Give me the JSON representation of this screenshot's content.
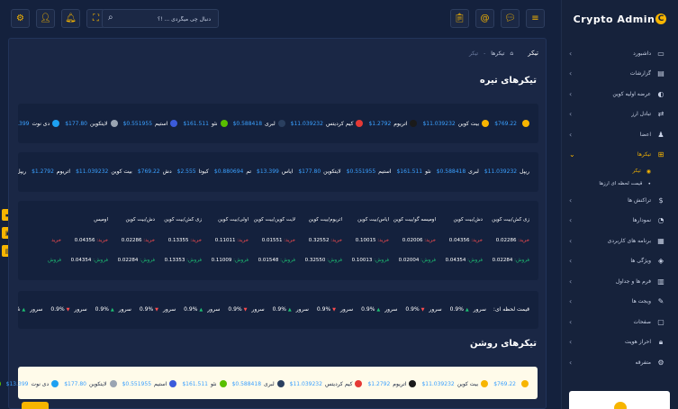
{
  "brand": {
    "name": "Crypto Admin",
    "mark": "C"
  },
  "sidebar": {
    "items": [
      {
        "label": "داشبورد",
        "icon": "monitor-icon"
      },
      {
        "label": "گزارشات",
        "icon": "report-icon"
      },
      {
        "label": "عرضه اولیه کوین",
        "icon": "coin-icon"
      },
      {
        "label": "تبادل ارز",
        "icon": "exchange-icon"
      },
      {
        "label": "اعضا",
        "icon": "users-icon"
      },
      {
        "label": "تیکرها",
        "icon": "ticker-icon"
      },
      {
        "label": "تراکنش ها",
        "icon": "dollar-icon"
      },
      {
        "label": "نمودارها",
        "icon": "chart-icon"
      },
      {
        "label": "برنامه های کاربردی",
        "icon": "apps-icon"
      },
      {
        "label": "ویژگی ها",
        "icon": "features-icon"
      },
      {
        "label": "فرم ها و جداول",
        "icon": "forms-icon"
      },
      {
        "label": "ویجت ها",
        "icon": "widgets-icon"
      },
      {
        "label": "صفحات",
        "icon": "pages-icon"
      },
      {
        "label": "احراز هویت",
        "icon": "lock-icon"
      },
      {
        "label": "متفرقه",
        "icon": "misc-icon"
      }
    ],
    "subitems": [
      {
        "label": "تیکر"
      },
      {
        "label": "قیمت لحظه ای ارزها"
      }
    ]
  },
  "header": {
    "search_placeholder": "دنبال چی میگردی ... !؟"
  },
  "breadcrumb": {
    "title": "تیکر",
    "home": "⌂",
    "level1": "تیکرها",
    "level2": "تیکر"
  },
  "sections": {
    "dark": "تیکرهای تیره",
    "light": "تیکرهای روشن"
  },
  "ticker1": [
    {
      "name": "",
      "price": "$769.22",
      "color": "#f7b500"
    },
    {
      "name": "بیت کوین",
      "price": "$11.039232",
      "color": "#f7b500"
    },
    {
      "name": "اتریوم",
      "price": "$1.2792",
      "color": "#1a1a1a"
    },
    {
      "name": "کیم کردیتس",
      "price": "$11.039232",
      "color": "#e53935"
    },
    {
      "name": "لبری",
      "price": "$0.588418",
      "color": "#2a3f5f"
    },
    {
      "name": "نئو",
      "price": "$161.511",
      "color": "#58bf00"
    },
    {
      "name": "استیم",
      "price": "$0.551955",
      "color": "#3b5bdb"
    },
    {
      "name": "لایتکوین",
      "price": "$177.80",
      "color": "#9aa4b2"
    },
    {
      "name": "دی نوت",
      "price": "$13.399",
      "color": "#1da1f2"
    },
    {
      "name": "میت",
      "price": "",
      "color": "#58bf00"
    }
  ],
  "ticker2": [
    {
      "name": "ریپل",
      "price": "$11.039232"
    },
    {
      "name": "لبری",
      "price": "$0.588418"
    },
    {
      "name": "نئو",
      "price": "$161.511"
    },
    {
      "name": "استیم",
      "price": "$0.551955"
    },
    {
      "name": "لایتکوین",
      "price": "$177.80"
    },
    {
      "name": "ایاس",
      "price": "$13.399"
    },
    {
      "name": "تم",
      "price": "$0.880694"
    },
    {
      "name": "کیوتا",
      "price": "$2.555"
    },
    {
      "name": "دش",
      "price": "$769.22"
    },
    {
      "name": "بیت کوین",
      "price": "$11.039232"
    },
    {
      "name": "اتریوم",
      "price": "$1.2792"
    },
    {
      "name": "ریپل",
      "price": "$11.039232"
    }
  ],
  "table": {
    "headers": [
      "زی کش/بیت کوین",
      "دش/بیت کوین",
      "اومیسه گو/بیت کوین",
      "ایاس/بیت کوین",
      "اتریوم/بیت کوین",
      "لایت کوین/بیت کوین",
      "اولی/بیت کوین",
      "زی کش/بیت کوین",
      "دش/بیت کوین",
      "اومیس"
    ],
    "buy_label": "خرید:",
    "sell_label": "فروش:",
    "buy": [
      "0.02286",
      "0.04356",
      "0.02006",
      "0.10015",
      "0.32552",
      "0.01551",
      "0.11011",
      "0.13355",
      "0.02286",
      "0.04356",
      "خرید"
    ],
    "sell": [
      "0.02284",
      "0.04354",
      "0.02004",
      "0.10013",
      "0.32550",
      "0.01548",
      "0.11009",
      "0.13353",
      "0.02284",
      "0.04354",
      "فروش"
    ]
  },
  "ticker3": {
    "label": "قیمت لحظه ای:",
    "item": "سرور",
    "value": "0.9%",
    "count": 14
  },
  "colors": {
    "accent": "#f7b500",
    "buy": "#ff4d4f",
    "sell": "#1dbf73",
    "price": "#3aa0ff"
  }
}
